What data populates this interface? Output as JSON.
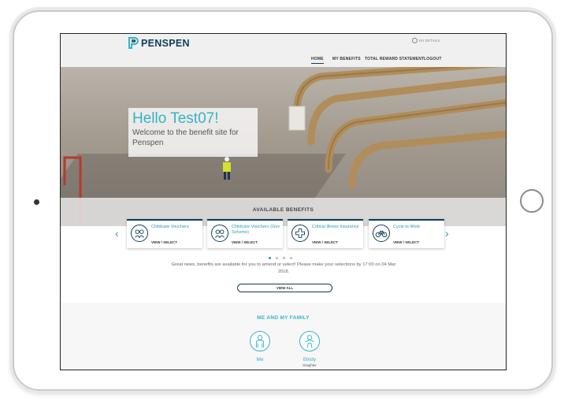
{
  "brand": {
    "name": "PENSPEN",
    "primary_color": "#0c3d58",
    "accent_color": "#34b3c9"
  },
  "header": {
    "my_details": "MY DETAILS",
    "nav": {
      "home": "HOME",
      "my_benefits": "MY BENEFITS",
      "total_reward": "TOTAL REWARD STATEMENT",
      "logout": "LOGOUT"
    }
  },
  "hero": {
    "title": "Hello Test07!",
    "subtitle": "Welcome to the benefit site for Penspen"
  },
  "benefits": {
    "heading": "AVAILABLE BENEFITS",
    "prev_arrow": "‹",
    "next_arrow": "›",
    "cards": [
      {
        "title": "Childcare Vouchers",
        "action": "VIEW / SELECT",
        "icon": "childcare-icon"
      },
      {
        "title": "Childcare Vouchers (Gov Scheme)",
        "action": "VIEW / SELECT",
        "icon": "childcare-gov-icon"
      },
      {
        "title": "Critical Illness Insurance",
        "action": "VIEW / SELECT",
        "icon": "medical-cross-icon"
      },
      {
        "title": "Cycle to Work",
        "action": "VIEW / SELECT",
        "icon": "bicycle-icon"
      }
    ],
    "notice": "Great news, benefits are available for you to amend or select! Please make your selections by 17:00 on 04 Mar 2018.",
    "view_all": "VIEW ALL"
  },
  "family": {
    "heading": "ME AND MY FAMILY",
    "members": [
      {
        "name": "Me",
        "role": ""
      },
      {
        "name": "Bindy",
        "role": "Daughter"
      }
    ]
  }
}
